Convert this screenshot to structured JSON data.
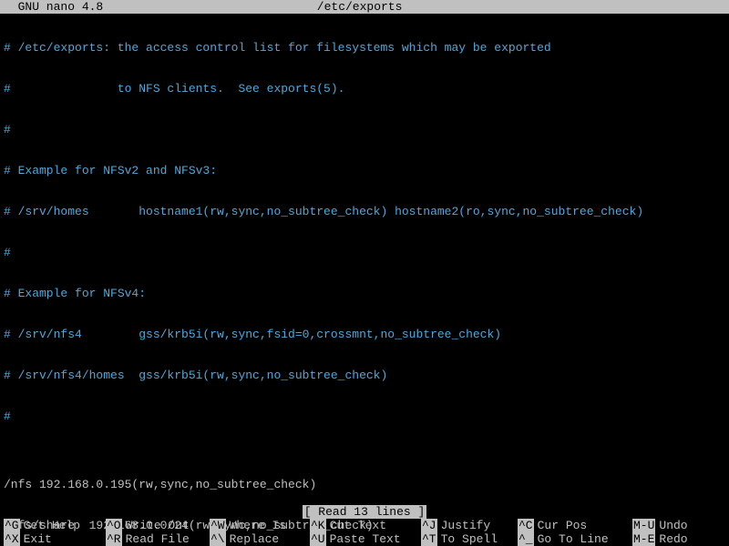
{
  "titlebar": {
    "app": "  GNU nano 4.8",
    "filename": "/etc/exports"
  },
  "lines": [
    {
      "comment": true,
      "text": "# /etc/exports: the access control list for filesystems which may be exported"
    },
    {
      "comment": true,
      "text": "#               to NFS clients.  See exports(5)."
    },
    {
      "comment": true,
      "text": "#"
    },
    {
      "comment": true,
      "text": "# Example for NFSv2 and NFSv3:"
    },
    {
      "comment": true,
      "text": "# /srv/homes       hostname1(rw,sync,no_subtree_check) hostname2(ro,sync,no_subtree_check)"
    },
    {
      "comment": true,
      "text": "#"
    },
    {
      "comment": true,
      "text": "# Example for NFSv4:"
    },
    {
      "comment": true,
      "text": "# /srv/nfs4        gss/krb5i(rw,sync,fsid=0,crossmnt,no_subtree_check)"
    },
    {
      "comment": true,
      "text": "# /srv/nfs4/homes  gss/krb5i(rw,sync,no_subtree_check)"
    },
    {
      "comment": true,
      "text": "#"
    },
    {
      "comment": false,
      "text": ""
    },
    {
      "comment": false,
      "text": "/nfs 192.168.0.195(rw,sync,no_subtree_check)"
    },
    {
      "comment": false,
      "text": "/nfs/share  192.168.0.0/24(rw,sync,no_subtree_check)"
    }
  ],
  "status": "[ Read 13 lines ]",
  "shortcuts": {
    "row1": [
      {
        "key": "^G",
        "label": "Get Help"
      },
      {
        "key": "^O",
        "label": "Write Out"
      },
      {
        "key": "^W",
        "label": "Where Is"
      },
      {
        "key": "^K",
        "label": "Cut Text"
      },
      {
        "key": "^J",
        "label": "Justify"
      },
      {
        "key": "^C",
        "label": "Cur Pos"
      },
      {
        "key": "M-U",
        "label": "Undo"
      }
    ],
    "row2": [
      {
        "key": "^X",
        "label": "Exit"
      },
      {
        "key": "^R",
        "label": "Read File"
      },
      {
        "key": "^\\",
        "label": "Replace"
      },
      {
        "key": "^U",
        "label": "Paste Text"
      },
      {
        "key": "^T",
        "label": "To Spell"
      },
      {
        "key": "^_",
        "label": "Go To Line"
      },
      {
        "key": "M-E",
        "label": "Redo"
      }
    ]
  }
}
